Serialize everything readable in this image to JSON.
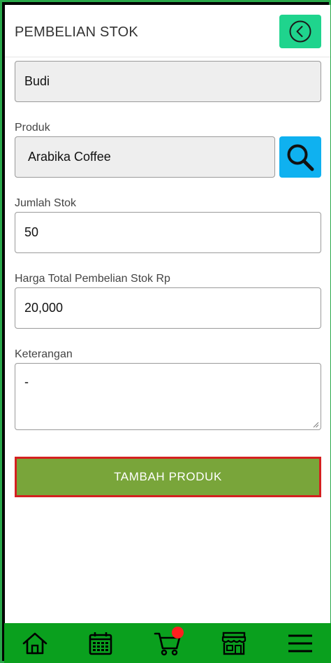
{
  "header": {
    "title": "PEMBELIAN STOK",
    "back_icon": "chevron-left-circle-icon"
  },
  "form": {
    "supplier": {
      "value": "Budi"
    },
    "product": {
      "label": "Produk",
      "value": "Arabika Coffee",
      "search_icon": "search-icon"
    },
    "stock_qty": {
      "label": "Jumlah Stok",
      "value": "50"
    },
    "total_price": {
      "label": "Harga Total Pembelian Stok Rp",
      "value": "20,000"
    },
    "notes": {
      "label": "Keterangan",
      "value": "-"
    },
    "submit_label": "TAMBAH PRODUK"
  },
  "bottom_nav": {
    "items": [
      {
        "icon": "home-icon"
      },
      {
        "icon": "calendar-icon"
      },
      {
        "icon": "cart-icon",
        "badge": true
      },
      {
        "icon": "store-icon"
      },
      {
        "icon": "menu-icon"
      }
    ]
  },
  "colors": {
    "accent_green": "#1fd48d",
    "search_blue": "#0fb1f0",
    "submit_green": "#79a53a",
    "submit_border": "#d42020",
    "nav_green": "#0aa01e",
    "badge_red": "#ff1e1e"
  }
}
